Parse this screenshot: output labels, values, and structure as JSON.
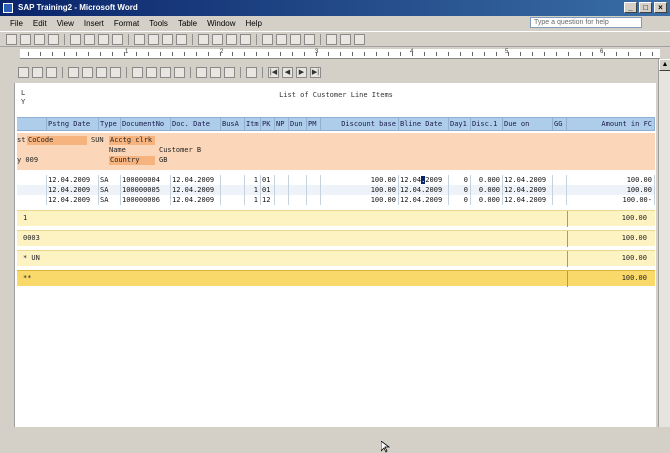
{
  "window": {
    "title": "SAP Training2 - Microsoft Word",
    "controls": [
      "_",
      "□",
      "×"
    ]
  },
  "menu": {
    "items": [
      "File",
      "Edit",
      "View",
      "Insert",
      "Format",
      "Tools",
      "Table",
      "Window",
      "Help"
    ],
    "help_placeholder": "Type a question for help"
  },
  "ruler": {
    "numbers": [
      "1",
      "2",
      "3",
      "4",
      "5",
      "6"
    ]
  },
  "report": {
    "title": "List of Customer Line Items",
    "corner": [
      "L",
      "Y"
    ],
    "columns": [
      "",
      "Pstng Date",
      "Type",
      "DocumentNo",
      "Doc. Date",
      "BusA",
      "Itm",
      "PK",
      "NP",
      "Dun",
      "PM",
      "Discount base",
      "Bline Date",
      "Day1",
      "Disc.1",
      "Due on",
      "GG",
      "Amount in FC"
    ],
    "header_block": {
      "st": "st",
      "cocode_label": "CoCode",
      "cocode_value": "SUN",
      "clerk_label": "Acctg clrk",
      "name_label": "Name",
      "name_value": "Customer B",
      "country_label": "Country",
      "country_value": "GB",
      "y_label": "y 009"
    },
    "rows": [
      {
        "pstng": "12.04.2009",
        "type": "SA",
        "docno": "100000004",
        "docdate": "12.04.2009",
        "itm": "1",
        "pk": "01",
        "disc_base": "100.00",
        "bline_a": "12.04",
        "bline_b": "2009",
        "day1": "0",
        "disc1": "0.000",
        "due": "12.04.2009",
        "amount": "100.00"
      },
      {
        "pstng": "12.04.2009",
        "type": "SA",
        "docno": "100000005",
        "docdate": "12.04.2009",
        "itm": "1",
        "pk": "01",
        "disc_base": "100.00",
        "bline_a": "12.04.",
        "bline_b": "2009",
        "day1": "0",
        "disc1": "0.000",
        "due": "12.04.2009",
        "amount": "100.00"
      },
      {
        "pstng": "12.04.2009",
        "type": "SA",
        "docno": "100000006",
        "docdate": "12.04.2009",
        "itm": "1",
        "pk": "12",
        "disc_base": "100.00",
        "bline_a": "12.04.",
        "bline_b": "2009",
        "day1": "0",
        "disc1": "0.000",
        "due": "12.04.2009",
        "amount": "100.00-"
      }
    ],
    "totals": [
      {
        "label": "1",
        "amount": "100.00"
      },
      {
        "label": "0003",
        "amount": "100.00"
      },
      {
        "label": "* UN",
        "amount": "100.00"
      },
      {
        "label": "**",
        "amount": "100.00"
      }
    ]
  }
}
